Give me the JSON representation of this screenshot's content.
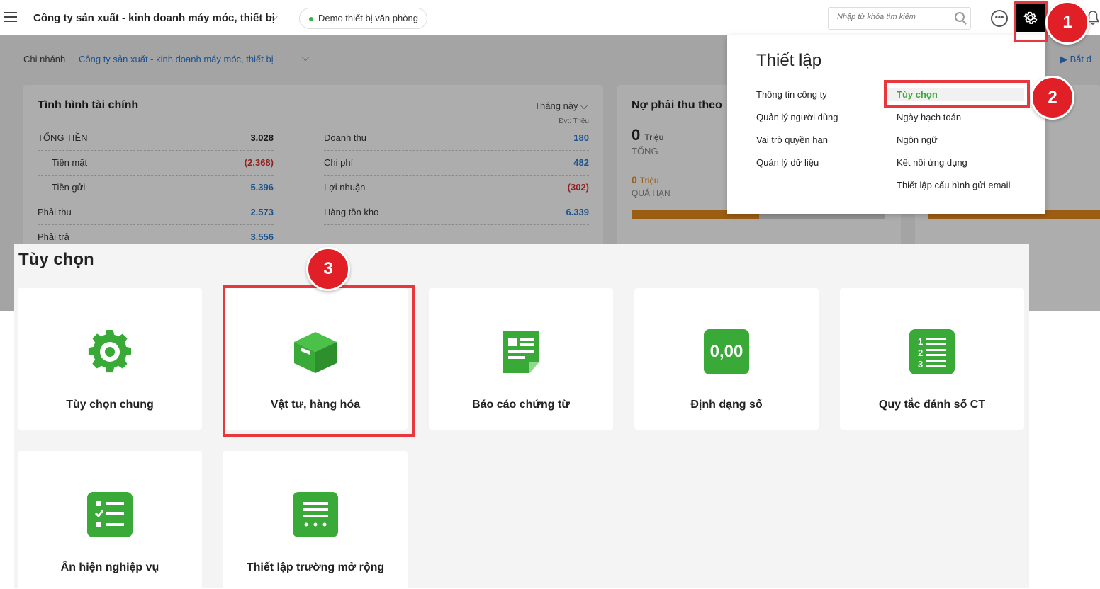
{
  "header": {
    "company": "Công ty sản xuất - kinh doanh máy móc, thiết bị",
    "demo_label": "Demo thiết bị văn phòng",
    "search_placeholder": "Nhập từ khóa tìm kiếm",
    "more_glyph": "•••"
  },
  "steps": [
    "1",
    "2",
    "3"
  ],
  "dashboard": {
    "branch_label": "Chi nhánh",
    "branch_value": "Công ty sản xuất - kinh doanh máy móc, thiết bị",
    "intro_label": "Bắt đ",
    "finance": {
      "title": "Tình hình tài chính",
      "period": "Tháng này",
      "unit": "Đvt: Triệu",
      "left_rows": [
        {
          "label": "TỔNG TIỀN",
          "value": "3.028"
        },
        {
          "label": "Tiền mặt",
          "value": "(2.368)"
        },
        {
          "label": "Tiền gửi",
          "value": "5.396"
        },
        {
          "label": "Phải thu",
          "value": "2.573"
        },
        {
          "label": "Phải trả",
          "value": "3.556"
        }
      ],
      "right_rows": [
        {
          "label": "Doanh thu",
          "value": "180"
        },
        {
          "label": "Chi phí",
          "value": "482"
        },
        {
          "label": "Lợi nhuận",
          "value": "(302)"
        },
        {
          "label": "Hàng tồn kho",
          "value": "6.339"
        }
      ]
    },
    "receivable": {
      "title": "Nợ phải thu theo",
      "total_value": "0",
      "total_unit": "Triệu",
      "total_caption": "TỔNG",
      "overdue_value": "0",
      "overdue_unit": "Triệu",
      "overdue_caption": "QUÁ HẠN"
    }
  },
  "settings_menu": {
    "title": "Thiết lập",
    "left_items": [
      "Thông tin công ty",
      "Quản lý người dùng",
      "Vai trò quyền hạn",
      "Quản lý dữ liệu"
    ],
    "right_items": [
      "Tùy chọn",
      "Ngày hạch toán",
      "Ngôn ngữ",
      "Kết nối ứng dụng",
      "Thiết lập cấu hình gửi email"
    ]
  },
  "options": {
    "title": "Tùy chọn",
    "tiles": [
      {
        "label": "Tùy chọn chung",
        "icon": "gear-icon"
      },
      {
        "label": "Vật tư, hàng hóa",
        "icon": "box-icon"
      },
      {
        "label": "Báo cáo chứng từ",
        "icon": "document-icon"
      },
      {
        "label": "Định dạng số",
        "icon": "number-format-icon",
        "icon_text": "0,00"
      },
      {
        "label": "Quy tắc đánh số CT",
        "icon": "numbered-list-icon"
      },
      {
        "label": "Ẩn hiện nghiệp vụ",
        "icon": "checklist-icon"
      },
      {
        "label": "Thiết lập trường mở rộng",
        "icon": "extended-fields-icon"
      }
    ]
  },
  "colors": {
    "accent_green": "#39a937",
    "highlight_red": "#e8383d",
    "step_red": "#e11f26",
    "link_blue": "#2a7bd4",
    "negative_red": "#d8302f",
    "warning_orange": "#e38a1b"
  }
}
